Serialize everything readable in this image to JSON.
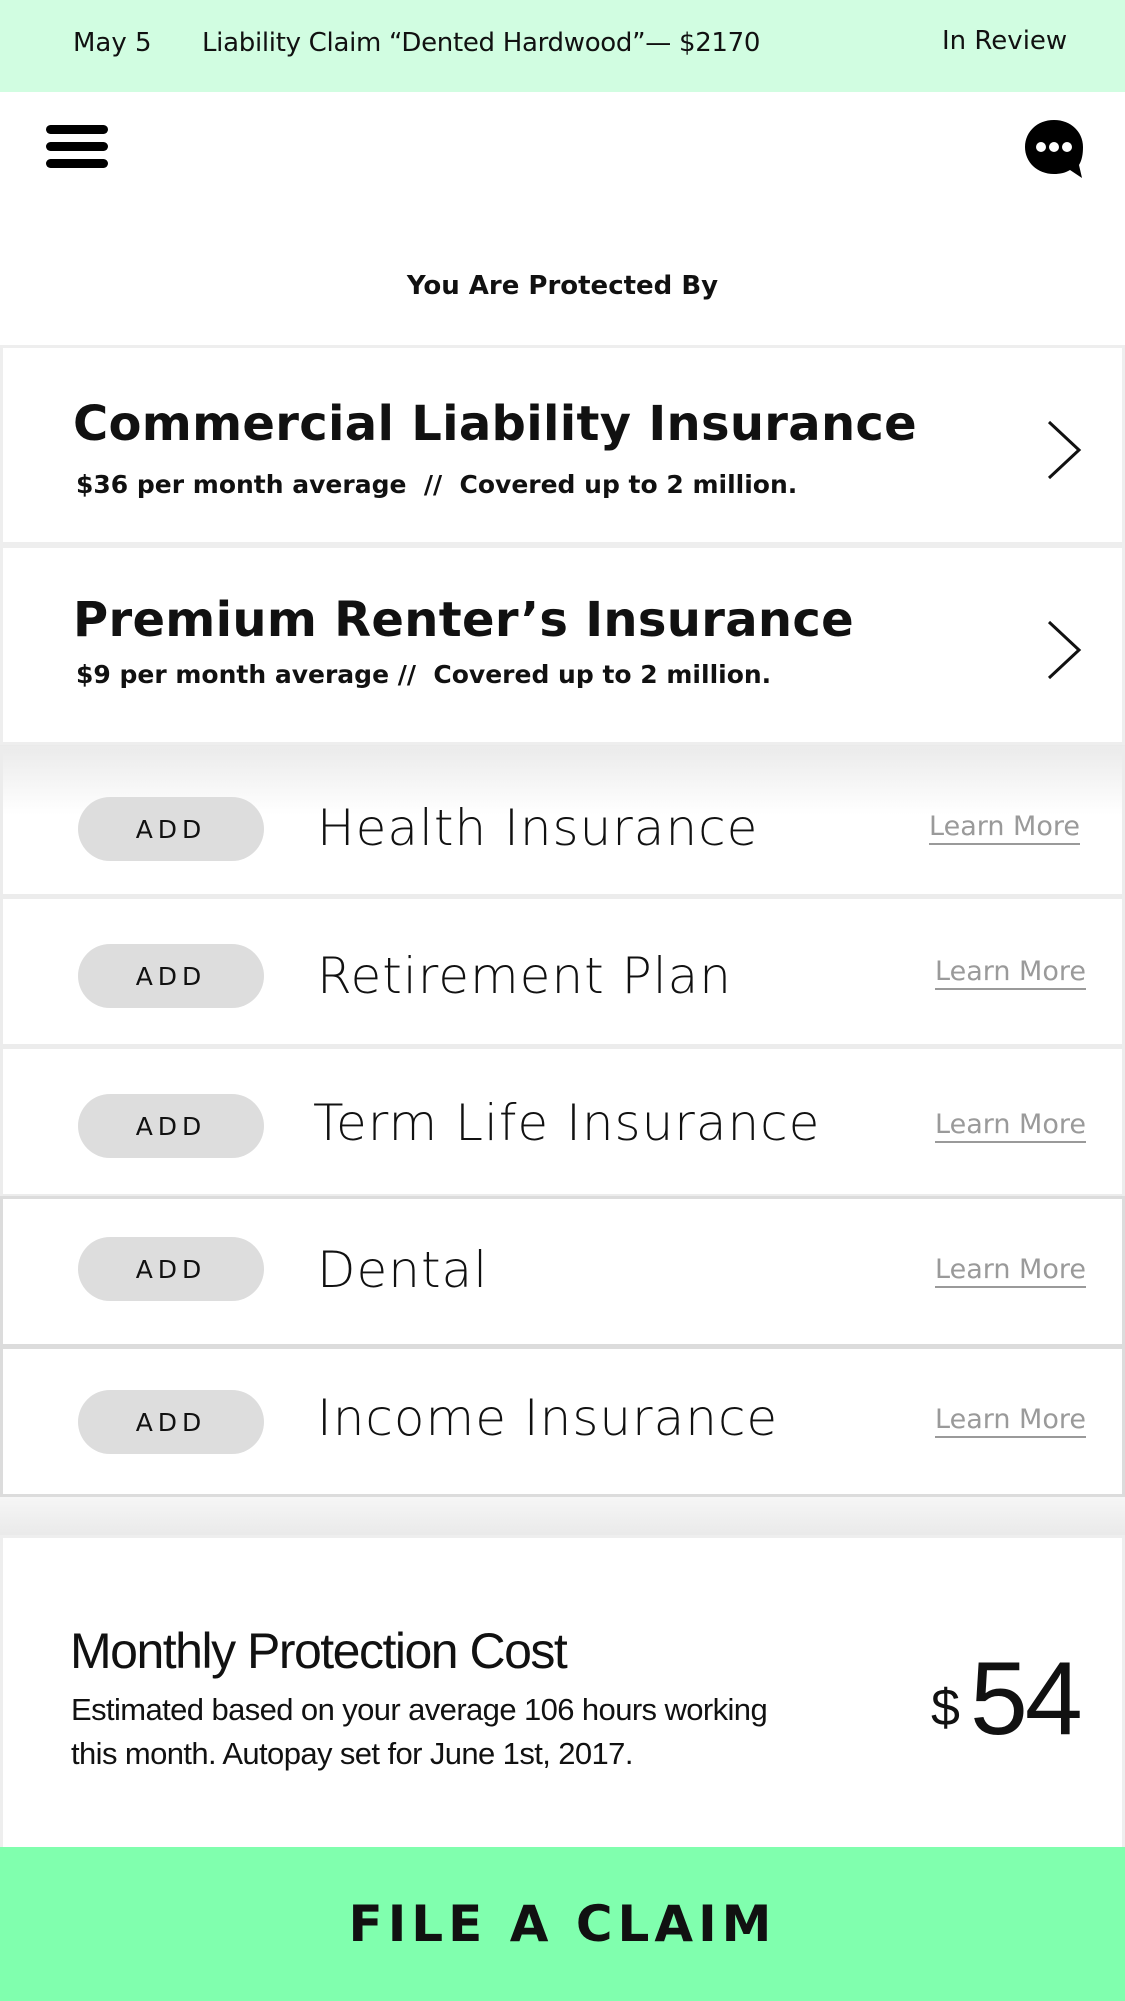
{
  "banner": {
    "date": "May 5",
    "claim": "Liability Claim “Dented Hardwood”— $2170",
    "status": "In Review",
    "background": "#d1fde1"
  },
  "nav": {
    "menu_icon": "hamburger-menu-icon",
    "chat_icon": "chat-bubble-icon"
  },
  "protected": {
    "heading": "You Are Protected By",
    "policies": [
      {
        "title": "Commercial Liability Insurance",
        "details": "$36 per month average  //  Covered up to 2 million."
      },
      {
        "title": "Premium Renter’s Insurance",
        "details": "$9 per month average //  Covered up to 2 million."
      }
    ]
  },
  "options": [
    {
      "add_label": "ADD",
      "name": "Health Insurance",
      "learn": "Learn More"
    },
    {
      "add_label": "ADD",
      "name": "Retirement Plan",
      "learn": "Learn More"
    },
    {
      "add_label": "ADD",
      "name": "Term Life Insurance",
      "learn": "Learn More"
    },
    {
      "add_label": "ADD",
      "name": "Dental",
      "learn": "Learn More"
    },
    {
      "add_label": "ADD",
      "name": "Income Insurance",
      "learn": "Learn More"
    }
  ],
  "cost": {
    "title": "Monthly Protection Cost",
    "description": "Estimated based on your average 106 hours working this month.  Autopay set for June 1st, 2017.",
    "currency": "$",
    "amount": "54"
  },
  "cta": {
    "label": "FILE A CLAIM",
    "color": "#80ffae"
  }
}
